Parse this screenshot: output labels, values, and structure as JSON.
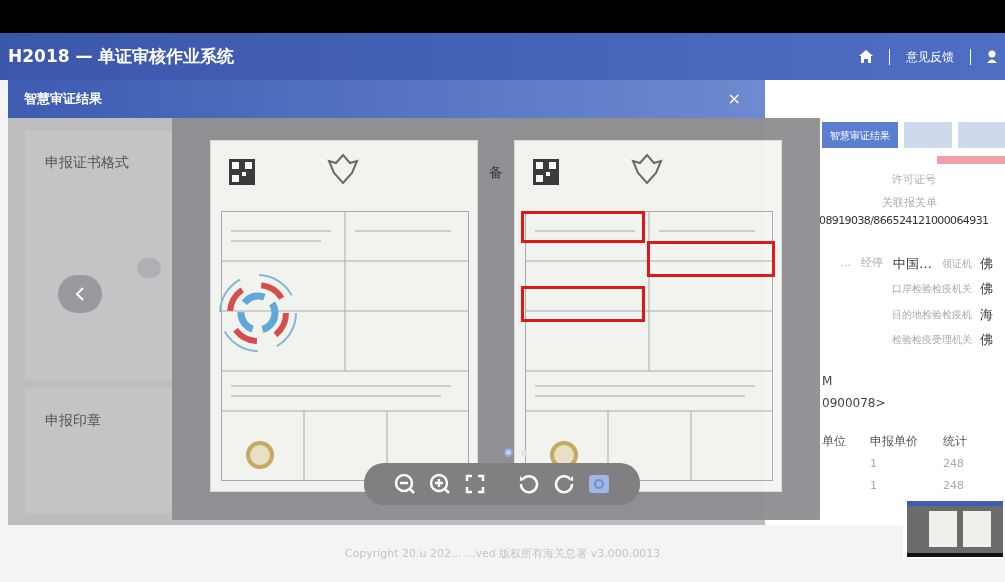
{
  "header": {
    "title": "H2018 — 单证审核作业系统",
    "links": [
      "意见反馈"
    ]
  },
  "modal": {
    "title": "智慧审证结果",
    "close": "×",
    "sections": [
      "申报证书格式",
      "申报印章"
    ],
    "side_char": "备",
    "documents": [
      {
        "loading": true,
        "flagged": false
      },
      {
        "loading": false,
        "flagged": true
      }
    ],
    "pages": [
      {
        "selected": true
      },
      {
        "selected": false
      }
    ]
  },
  "page": {
    "tabs": [
      {
        "label": "智慧审证结果",
        "selected": true
      },
      {
        "selected": false
      },
      {
        "selected": false
      }
    ],
    "field_labels": [
      "许可证号",
      "关联报关单"
    ],
    "reference": "08919038/866524121000064931",
    "rows": [
      {
        "label": "领证机",
        "value": "佛",
        "lead": "…",
        "extra": "经停",
        "extra_value": "中国…"
      },
      {
        "label": "口岸检验检疫机关",
        "value": "佛"
      },
      {
        "label": "目的地检验检疫机",
        "value": "海"
      },
      {
        "label": "检验检疫受理机关",
        "value": "佛"
      }
    ],
    "notes": [
      "M",
      "0900078>"
    ],
    "table": {
      "columns": [
        "单位",
        "申报单价",
        "统计"
      ],
      "rows": [
        [
          "",
          "1",
          "248"
        ],
        [
          "",
          "1",
          "248"
        ]
      ]
    }
  },
  "footer": "Copyright 20.u 202... ...ved 版权所有海关总署 v3.000.0013"
}
